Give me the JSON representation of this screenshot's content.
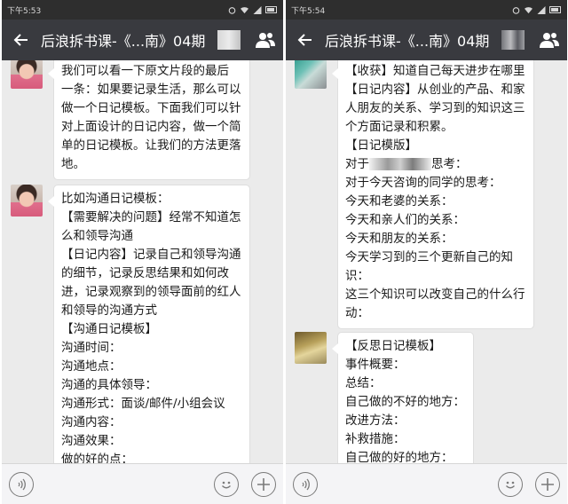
{
  "left": {
    "status_time": "下午5:53",
    "title": "后浪拆书课-《...南》04期",
    "messages": [
      {
        "lines": [
          "我们可以看一下原文片段的最后",
          "一条：如果要记录生活，那么可以",
          "做一个日记模板。下面我们可以针",
          "对上面设计的日记内容，做一个简",
          "单的日记模板。让我们的方法更落",
          "地。"
        ]
      },
      {
        "lines": [
          "比如沟通日记模板：",
          "【需要解决的问题】经常不知道怎",
          "么和领导沟通",
          "【日记内容】记录自己和领导沟通",
          "的细节，记录反思结果和如何改",
          "进，记录观察到的领导面前的红人",
          "和领导的沟通方式",
          "【沟通日记模板】",
          "沟通时间：",
          "沟通地点：",
          "沟通的具体领导：",
          "沟通形式：面谈/邮件/小组会议",
          "沟通内容：",
          "沟通效果：",
          "做的好的点："
        ]
      }
    ]
  },
  "right": {
    "status_time": "下午5:54",
    "title": "后浪拆书课-《...南》04期",
    "messages": [
      {
        "lines": [
          "【收获】知道自己每天进步在哪里",
          "【日记内容】从创业的产品、和家",
          "人朋友的关系、学习到的知识这三",
          "个方面记录和积累。",
          "【日记模版】",
          "思考：",
          "对于今天咨询的同学的思考：",
          "今天和老婆的关系：",
          "今天和亲人们的关系：",
          "今天和朋友的关系：",
          "今天学习到的三个更新自己的知",
          "识：",
          "这三个知识可以改变自己的什么行",
          "动："
        ],
        "redacted_prefix": "对于"
      },
      {
        "lines": [
          "【反思日记模板】",
          "事件概要：",
          "总结：",
          "自己做的不好的地方：",
          "改进方法：",
          "补救措施：",
          "自己做的好的地方："
        ]
      }
    ]
  },
  "icons": {
    "back": "back-arrow-icon",
    "people": "group-members-icon",
    "voice": "voice-input-icon",
    "emoji": "emoji-icon",
    "plus": "plus-icon"
  },
  "colors": {
    "status_bar": "#2e2e2e",
    "title_bar": "#393a3f",
    "chat_bg": "#ebebeb",
    "bubble": "#ffffff"
  }
}
